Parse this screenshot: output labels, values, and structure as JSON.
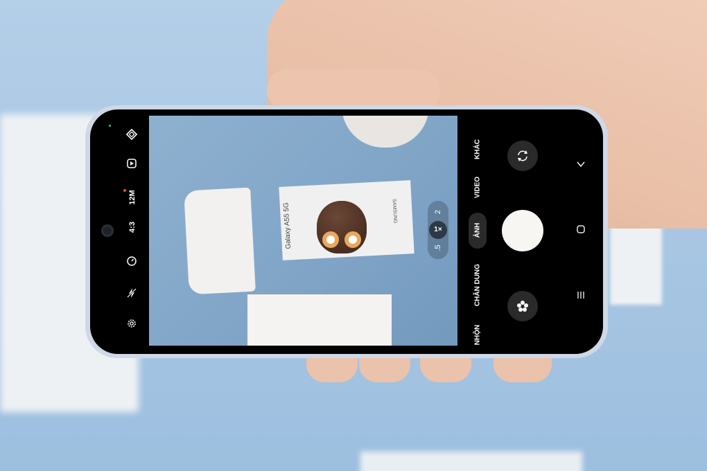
{
  "camera": {
    "left_toolbar": {
      "resolution": "12M",
      "aspect_ratio": "4:3",
      "icons": [
        "filter-icon",
        "motion-photo-icon",
        "timer-icon",
        "flash-off-icon",
        "settings-icon"
      ]
    },
    "zoom": {
      "options": [
        ".5",
        "1×",
        "2"
      ],
      "selected": "1×"
    },
    "modes": {
      "items": [
        "KHÁC",
        "VIDEO",
        "ẢNH",
        "CHÂN DUNG",
        "NHỘN"
      ],
      "active": "ẢNH"
    },
    "viewfinder": {
      "box_model": "Galaxy A55 5G",
      "box_brand": "SAMSUNG"
    }
  },
  "colors": {
    "shutter": "#f8f6f3",
    "accent_dot": "#ff4a2a"
  }
}
